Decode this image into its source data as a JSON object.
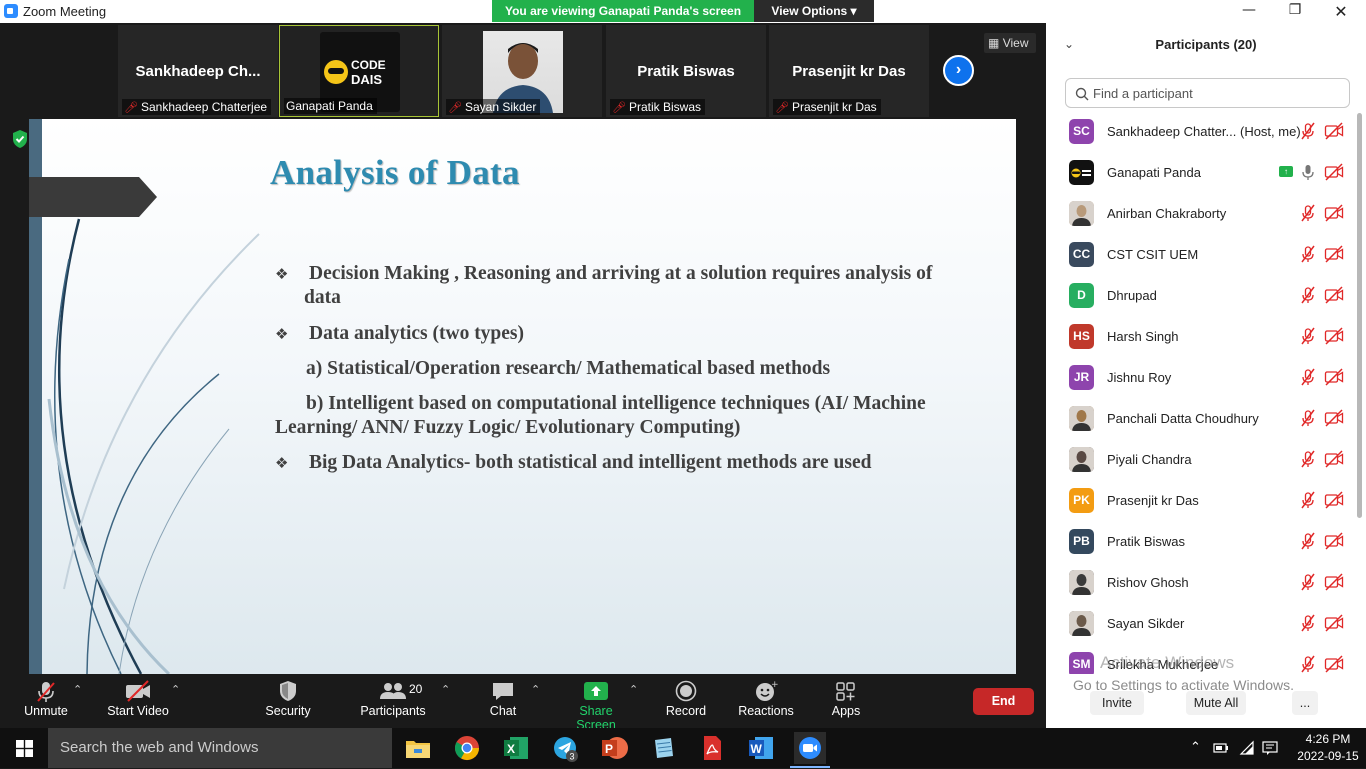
{
  "window": {
    "title": "Zoom Meeting"
  },
  "banner": {
    "viewing": "You are viewing Ganapati Panda's screen",
    "view_options": "View Options ▾"
  },
  "strip": {
    "tiles": [
      {
        "display": "Sankhadeep  Ch...",
        "label": "Sankhadeep Chatterjee",
        "muted": true
      },
      {
        "display": "",
        "label": "Ganapati Panda",
        "muted": false,
        "logo_text": "CODE DAIS"
      },
      {
        "display": "",
        "label": "Sayan Sikder",
        "muted": true
      },
      {
        "display": "Pratik Biswas",
        "label": "Pratik Biswas",
        "muted": true
      },
      {
        "display": "Prasenjit  kr Das",
        "label": "Prasenjit  kr Das",
        "muted": true
      }
    ],
    "view_label": "View"
  },
  "slide": {
    "title": "Analysis of Data",
    "bullet_glyph": "❖",
    "bullets": [
      {
        "line1": "Decision Making , Reasoning and arriving at a solution requires analysis of",
        "line2": "data"
      },
      {
        "line1": "Data analytics (two types)"
      },
      {
        "line1": "a) Statistical/Operation research/ Mathematical based methods"
      },
      {
        "line1": "b) Intelligent based on computational intelligence techniques (AI/ Machine",
        "line2": "Learning/ ANN/ Fuzzy Logic/ Evolutionary Computing)"
      },
      {
        "line1": "Big Data Analytics- both statistical and intelligent methods are used"
      }
    ]
  },
  "toolbar": {
    "unmute": "Unmute",
    "start_video": "Start Video",
    "security": "Security",
    "participants": "Participants",
    "participants_count": "20",
    "chat": "Chat",
    "share_screen": "Share Screen",
    "record": "Record",
    "reactions": "Reactions",
    "apps": "Apps",
    "end": "End"
  },
  "panel": {
    "title": "Participants (20)",
    "search_placeholder": "Find a participant",
    "participants": [
      {
        "initials": "SC",
        "name": "Sankhadeep Chatter...  (Host, me)",
        "color": "#8e44ad",
        "type": "initials"
      },
      {
        "initials": "",
        "name": "Ganapati Panda",
        "color": "#111111",
        "type": "logo",
        "sharing": true
      },
      {
        "initials": "",
        "name": "Anirban Chakraborty",
        "color": "#b89a7a",
        "type": "photo"
      },
      {
        "initials": "CC",
        "name": "CST CSIT UEM",
        "color": "#3a4a5e",
        "type": "initials"
      },
      {
        "initials": "D",
        "name": "Dhrupad",
        "color": "#27ae60",
        "type": "initials"
      },
      {
        "initials": "HS",
        "name": "Harsh Singh",
        "color": "#c0392b",
        "type": "initials"
      },
      {
        "initials": "JR",
        "name": "Jishnu Roy",
        "color": "#8e44ad",
        "type": "initials"
      },
      {
        "initials": "",
        "name": "Panchali Datta Choudhury",
        "color": "#a0784a",
        "type": "photo"
      },
      {
        "initials": "",
        "name": "Piyali Chandra",
        "color": "#5a4a44",
        "type": "photo"
      },
      {
        "initials": "PK",
        "name": "Prasenjit  kr Das",
        "color": "#f39c12",
        "type": "initials"
      },
      {
        "initials": "PB",
        "name": "Pratik Biswas",
        "color": "#34495e",
        "type": "initials"
      },
      {
        "initials": "",
        "name": "Rishov Ghosh",
        "color": "#3b3b3b",
        "type": "photo"
      },
      {
        "initials": "",
        "name": "Sayan Sikder",
        "color": "#6b5a4a",
        "type": "photo"
      },
      {
        "initials": "SM",
        "name": "Srilekha Mukherjee",
        "color": "#8e44ad",
        "type": "initials"
      }
    ],
    "activate_title": "Activate Windows",
    "activate_sub": "Go to Settings to activate Windows.",
    "invite": "Invite",
    "mute_all": "Mute All",
    "more": "..."
  },
  "taskbar": {
    "search_placeholder": "Search the web and Windows",
    "time": "4:26 PM",
    "date": "2022-09-15",
    "apps": [
      "file-explorer",
      "chrome",
      "excel",
      "telegram",
      "powerpoint",
      "notepad",
      "acrobat",
      "word",
      "zoom"
    ],
    "telegram_badge": "3"
  }
}
